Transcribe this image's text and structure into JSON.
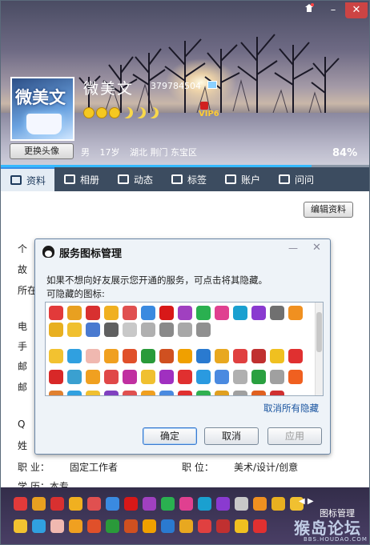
{
  "window": {
    "titlebar_skin": "skin-icon",
    "titlebar_min": "–",
    "titlebar_close": "✕"
  },
  "profile": {
    "avatar_text": "微美文",
    "nickname": "微美文",
    "qq_number": "379784504",
    "vip_label": "VIP6",
    "change_avatar_label": "更换头像",
    "gender": "男",
    "age": "17岁",
    "location": "湖北 荆门 东宝区",
    "completion_percent": "84%",
    "completion_value": 0.84
  },
  "tabs": [
    {
      "label": "资料",
      "icon": "profile-card-icon",
      "active": true
    },
    {
      "label": "相册",
      "icon": "photo-icon"
    },
    {
      "label": "动态",
      "icon": "feed-icon"
    },
    {
      "label": "标签",
      "icon": "tag-icon"
    },
    {
      "label": "账户",
      "icon": "wallet-icon"
    },
    {
      "label": "问问",
      "icon": "question-icon"
    }
  ],
  "content": {
    "edit_label": "编辑资料",
    "partial_labels": [
      "个",
      "故",
      "所在",
      "电",
      "手",
      "邮",
      "邮",
      "Q",
      "姓"
    ],
    "job_label": "职    业：",
    "job_value": "固定工作者",
    "position_label": "职    位：",
    "position_value": "美术/设计/创意",
    "cut_label": "学    历：本专"
  },
  "dialog": {
    "title": "服务图标管理",
    "min_label": "—",
    "close_label": "✕",
    "description": "如果不想向好友展示您开通的服务，可点击将其隐藏。",
    "hidden_label": "可隐藏的图标:",
    "unhide_all": "取消所有隐藏",
    "ok_label": "确定",
    "cancel_label": "取消",
    "apply_label": "应用"
  },
  "bottom_bar": {
    "manage_label": "图标管理",
    "arrows": "◀ ▶",
    "watermark": "猴岛论坛",
    "watermark_url": "BBS.HOUDAO.COM"
  },
  "colors": {
    "tab_bar": "#3c4c60",
    "active_tab": "#e4ecf4",
    "progress": "#35b9ff",
    "link": "#1a55a0"
  }
}
